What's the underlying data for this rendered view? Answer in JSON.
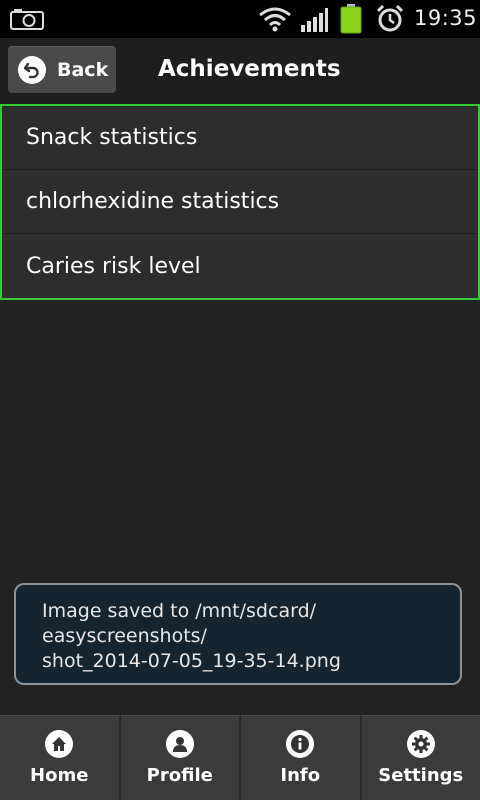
{
  "status_bar": {
    "time": "19:35",
    "icons": [
      "camera-icon",
      "wifi-icon",
      "signal-icon",
      "battery-icon",
      "alarm-clock-icon"
    ],
    "battery_color": "#8bd51a"
  },
  "header": {
    "back_label": "Back",
    "title": "Achievements"
  },
  "menu": {
    "items": [
      {
        "label": "Snack statistics"
      },
      {
        "label": "chlorhexidine statistics"
      },
      {
        "label": "Caries risk level"
      }
    ],
    "selected_border_color": "#33cc33"
  },
  "toast": {
    "lines": [
      "Image saved to /mnt/sdcard/",
      "easyscreenshots/",
      "shot_2014-07-05_19-35-14.png"
    ]
  },
  "bottom_nav": {
    "tabs": [
      {
        "label": "Home",
        "icon": "home-icon"
      },
      {
        "label": "Profile",
        "icon": "profile-icon"
      },
      {
        "label": "Info",
        "icon": "info-icon"
      },
      {
        "label": "Settings",
        "icon": "gear-icon"
      }
    ]
  }
}
